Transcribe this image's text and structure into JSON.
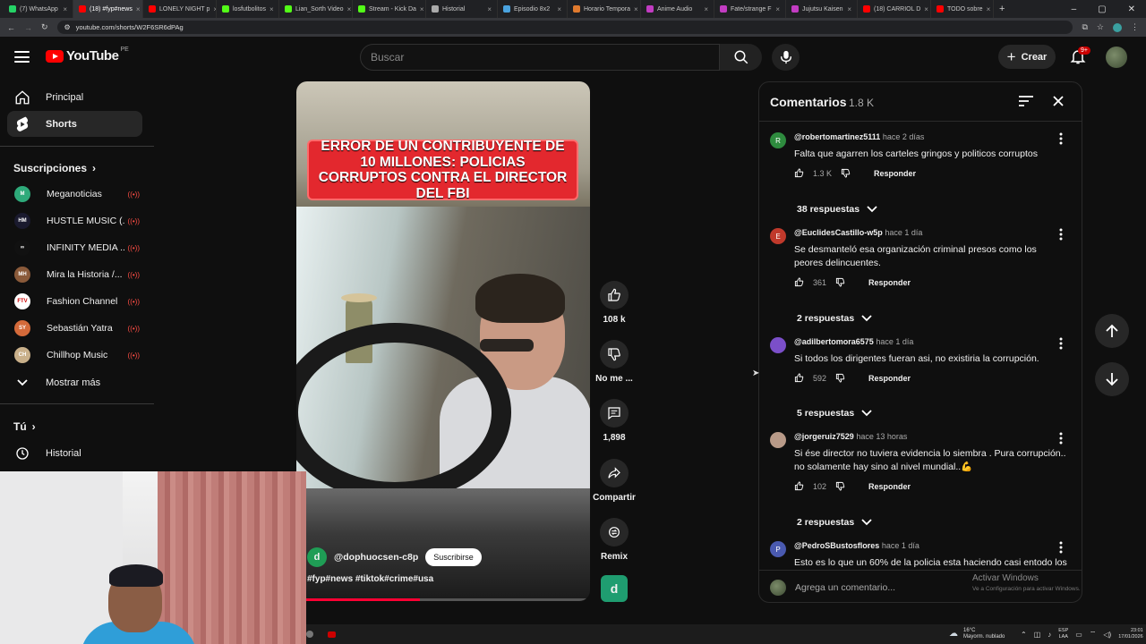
{
  "browser": {
    "tabs": [
      {
        "label": "(7) WhatsApp",
        "color": "#25d366"
      },
      {
        "label": "(18) #fyp#news",
        "color": "#ff0000"
      },
      {
        "label": "LONELY NIGHT p",
        "color": "#ff0000"
      },
      {
        "label": "losfutbolitos",
        "color": "#53fc18"
      },
      {
        "label": "Lian_Sorth Video",
        "color": "#53fc18"
      },
      {
        "label": "Stream - Kick Da",
        "color": "#53fc18"
      },
      {
        "label": "Historial",
        "color": "#aaaaaa"
      },
      {
        "label": "Episodio 8x2",
        "color": "#4aa3df"
      },
      {
        "label": "Horario Tempora",
        "color": "#e07a2e"
      },
      {
        "label": "Anime Audio",
        "color": "#c23cc2"
      },
      {
        "label": "Fate/strange F",
        "color": "#c23cc2"
      },
      {
        "label": "Jujutsu Kaisen",
        "color": "#c23cc2"
      },
      {
        "label": "(18) CARRIOL D",
        "color": "#ff0000"
      },
      {
        "label": "TODO sobre",
        "color": "#ff0000"
      }
    ],
    "url": "youtube.com/shorts/W2F6SR6dPAg"
  },
  "header": {
    "logo": "YouTube",
    "country": "PE",
    "search_placeholder": "Buscar",
    "create_label": "Crear",
    "notif_count": "9+"
  },
  "sidebar": {
    "home": "Principal",
    "shorts": "Shorts",
    "subs_heading": "Suscripciones",
    "subscriptions": [
      {
        "name": "Meganoticias",
        "color": "#2eaa7a",
        "initial": "M"
      },
      {
        "name": "HUSTLE MUSIC (...",
        "color": "#1a1a2e",
        "initial": "HM"
      },
      {
        "name": "INFINITY MEDIA ...",
        "color": "#111111",
        "initial": "∞"
      },
      {
        "name": "Mira la Historia /...",
        "color": "#8a5a3a",
        "initial": "MH"
      },
      {
        "name": "Fashion Channel",
        "color": "#ffffff",
        "initial": "FTV"
      },
      {
        "name": "Sebastián Yatra",
        "color": "#d46a3a",
        "initial": "SY"
      },
      {
        "name": "Chillhop Music",
        "color": "#c9b08a",
        "initial": "CH"
      }
    ],
    "show_more": "Mostrar más",
    "you_heading": "Tú",
    "history": "Historial"
  },
  "video": {
    "banner_text": "ERROR DE UN CONTRIBUYENTE DE 10 MILLONES: POLICIAS CORRUPTOS CONTRA EL DIRECTOR DEL FBI",
    "channel": "@dophuocsen-c8p",
    "channel_initial": "d",
    "subscribe_label": "Suscribirse",
    "tags": "#fyp#news #tiktok#crime#usa",
    "progress": 0.42
  },
  "actions": {
    "likes": "108 k",
    "dislike_label": "No me ...",
    "comments": "1,898",
    "share_label": "Compartir",
    "remix_label": "Remix",
    "sound_initial": "d"
  },
  "comments": {
    "title": "Comentarios",
    "count": "1.8 K",
    "items": [
      {
        "user": "@robertomartinez5111",
        "time": "hace 2 días",
        "text": "Falta que agarren los carteles gringos y politicos corruptos",
        "likes": "1.3 K",
        "replies": "38 respuestas",
        "avatar_color": "#2e8b3e",
        "initial": "R"
      },
      {
        "user": "@EuclidesCastillo-w5p",
        "time": "hace 1 día",
        "text": "Se  desmanteló esa organización criminal presos como los peores delincuentes.",
        "likes": "361",
        "replies": "2 respuestas",
        "avatar_color": "#c0392b",
        "initial": "E"
      },
      {
        "user": "@adilbertomora6575",
        "time": "hace 1 día",
        "text": "Si todos los dirigentes fueran asi, no existiria la corrupción.",
        "likes": "592",
        "replies": "5 respuestas",
        "avatar_color": "#7b4fc9",
        "initial": ""
      },
      {
        "user": "@jorgeruiz7529",
        "time": "hace 13 horas",
        "text": "Si ése director no tuviera evidencia lo siembra . Pura corrupción.. no solamente hay sino al nivel mundial..💪",
        "likes": "102",
        "replies": "2 respuestas",
        "avatar_color": "#b89a88",
        "initial": ""
      },
      {
        "user": "@PedroSBustosflores",
        "time": "hace 1 día",
        "text": "Esto es lo que un 60% de la policia esta haciendo casi entodo los",
        "likes": "",
        "replies": "",
        "avatar_color": "#4a5ab0",
        "initial": "P"
      }
    ],
    "reply_label": "Responder",
    "add_placeholder": "Agrega un comentario..."
  },
  "windows": {
    "activate_title": "Activar Windows",
    "activate_sub": "Ve a Configuración para activar Windows.",
    "temp": "16°C",
    "weather": "Mayorm. nublado",
    "lang": "ESP",
    "lang2": "LAA",
    "time": "23:01",
    "date": "17/01/2026"
  }
}
